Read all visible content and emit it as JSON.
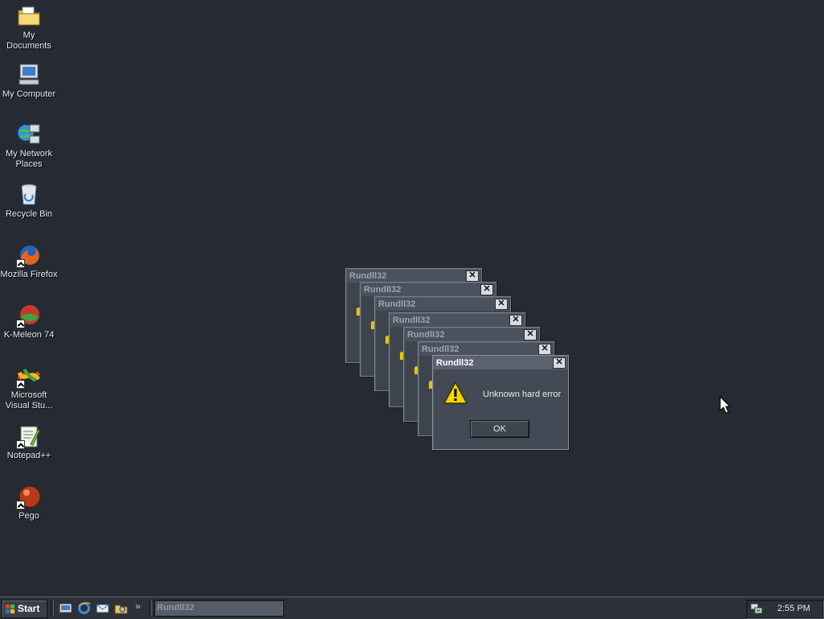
{
  "desktop": {
    "icons": [
      {
        "label": "My Documents",
        "icon": "folder-icon"
      },
      {
        "label": "My Computer",
        "icon": "computer-icon"
      },
      {
        "label": "My Network Places",
        "icon": "network-icon"
      },
      {
        "label": "Recycle Bin",
        "icon": "recycle-bin-icon"
      },
      {
        "label": "Mozilla Firefox",
        "icon": "firefox-icon"
      },
      {
        "label": "K-Meleon 74",
        "icon": "kmeleon-icon"
      },
      {
        "label": "Microsoft Visual Stu...",
        "icon": "visual-studio-icon"
      },
      {
        "label": "Notepad++",
        "icon": "notepadpp-icon"
      },
      {
        "label": "Pego",
        "icon": "pego-icon"
      }
    ]
  },
  "dialogs": {
    "stacked_titles": [
      "Rundll32",
      "Rundll32",
      "Rundll32",
      "Rundll32",
      "Rundll32",
      "Rundll32"
    ],
    "active": {
      "title": "Rundll32",
      "message": "Unknown hard error",
      "ok_label": "OK",
      "close_glyph": "✕"
    }
  },
  "taskbar": {
    "start_label": "Start",
    "chevron": "»",
    "task_label": "Rundll32",
    "clock": "2:55 PM"
  },
  "colors": {
    "desktop_bg": "#252a33",
    "warning_yellow": "#f2d400"
  }
}
